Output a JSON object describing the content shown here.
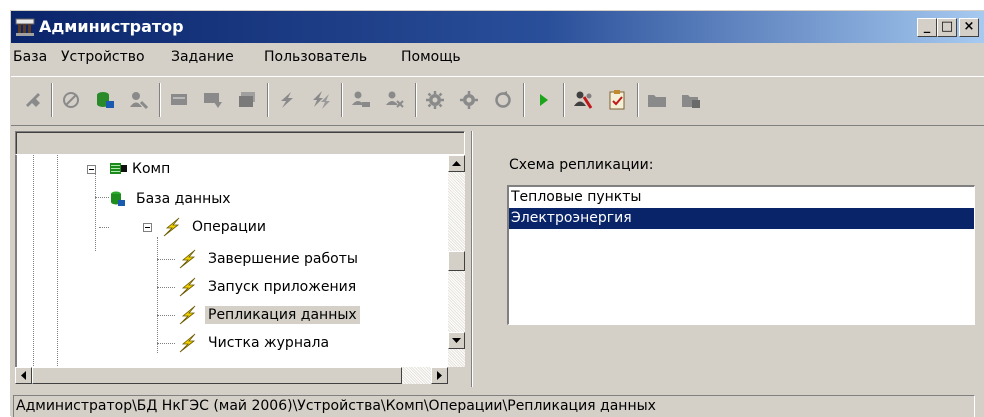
{
  "window": {
    "title": "Администратор",
    "min_glyph": "_",
    "max_glyph": "□",
    "close_glyph": "×"
  },
  "menu": [
    "База",
    "Устройство",
    "Задание",
    "Пользователь",
    "Помощь"
  ],
  "toolbar": {
    "icons": [
      "disconnect-icon",
      "cancel-icon",
      "add-database-icon",
      "add-user-icon",
      "card-icon",
      "card-arrow-icon",
      "card-stack-icon",
      "lightning-icon",
      "lightning-double-icon",
      "user-edit-icon",
      "user-remove-icon",
      "gear-icon",
      "gear-remove-icon",
      "refresh-icon",
      "run-icon",
      "user-tools-icon",
      "clipboard-check-icon",
      "folder-icon",
      "folder-open-icon"
    ]
  },
  "tree": {
    "nodes": [
      {
        "label": "Комп",
        "icon": "computer-icon"
      },
      {
        "label": "База данных",
        "icon": "database-icon"
      },
      {
        "label": "Операции",
        "icon": "lightning-icon"
      },
      {
        "label": "Завершение работы",
        "icon": "lightning-icon"
      },
      {
        "label": "Запуск приложения",
        "icon": "lightning-icon"
      },
      {
        "label": "Репликация данных",
        "icon": "lightning-icon",
        "selected": true
      },
      {
        "label": "Чистка журнала",
        "icon": "lightning-icon"
      }
    ]
  },
  "replication": {
    "label": "Схема репликации:",
    "items": [
      {
        "label": "Тепловые пункты",
        "selected": false
      },
      {
        "label": "Электроэнергия",
        "selected": true
      }
    ]
  },
  "status": {
    "path": "Администратор\\БД НкГЭС (май 2006)\\Устройства\\Комп\\Операции\\Репликация данных"
  },
  "colors": {
    "titlebar_start": "#0a246a",
    "selection": "#0a246a",
    "face": "#d4d0c8",
    "lightning": "#f2d000",
    "run": "#1aa51a"
  }
}
